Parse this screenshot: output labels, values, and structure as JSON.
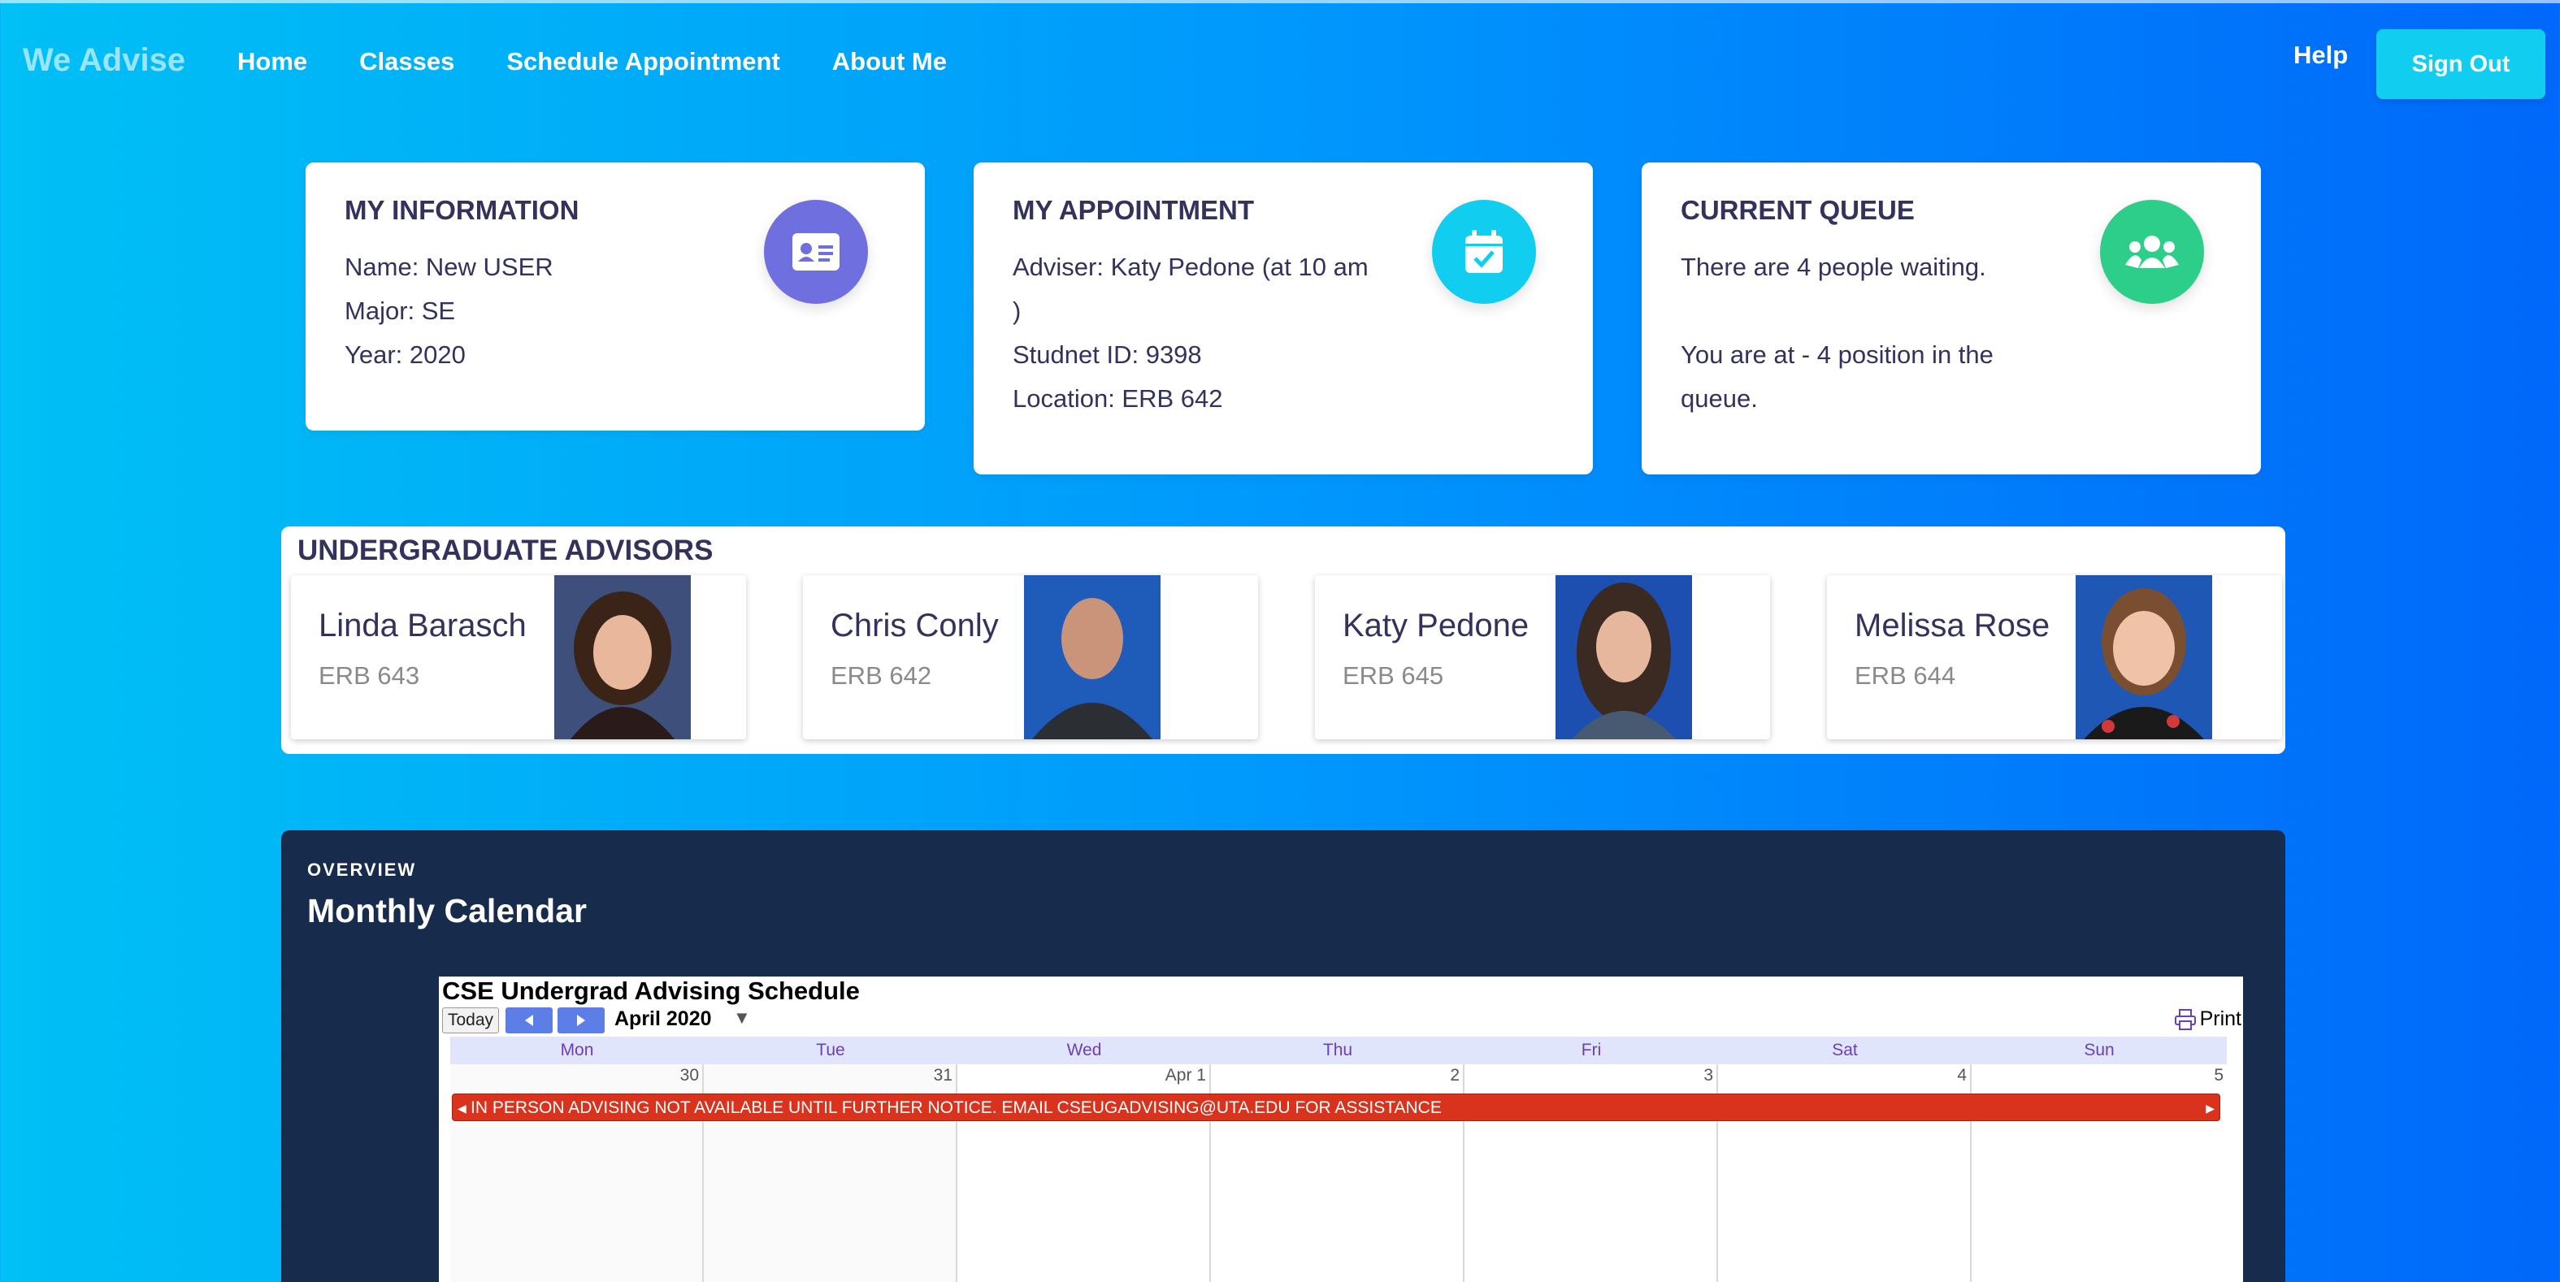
{
  "nav": {
    "brand": "We Advise",
    "links": [
      "Home",
      "Classes",
      "Schedule Appointment",
      "About Me"
    ],
    "help": "Help",
    "sign_out": "Sign Out"
  },
  "info_card": {
    "title": "MY INFORMATION",
    "lines": [
      "Name: New USER",
      "Major: SE",
      "Year: 2020"
    ],
    "icon": "id-card-icon",
    "icon_color": "#6f6fdf"
  },
  "appointment_card": {
    "title": "MY APPOINTMENT",
    "lines": [
      "Adviser: Katy Pedone (at 10 am",
      ")",
      "Studnet ID: 9398",
      "Location: ERB 642"
    ],
    "icon": "calendar-check-icon",
    "icon_color": "#11cdef"
  },
  "queue_card": {
    "title": "CURRENT QUEUE",
    "line1": "There are 4 people waiting.",
    "line2": "You are at - 4 position in the",
    "line3": "queue.",
    "icon": "users-icon",
    "icon_color": "#2dce89"
  },
  "advisors": {
    "title": "UNDERGRADUATE ADVISORS",
    "items": [
      {
        "name": "Linda Barasch",
        "room": "ERB 643"
      },
      {
        "name": "Chris Conly",
        "room": "ERB 642"
      },
      {
        "name": "Katy Pedone",
        "room": "ERB 645"
      },
      {
        "name": "Melissa Rose",
        "room": "ERB 644"
      }
    ]
  },
  "overview": {
    "label": "OVERVIEW",
    "title": "Monthly Calendar"
  },
  "calendar": {
    "title": "CSE Undergrad Advising Schedule",
    "today_label": "Today",
    "month": "April 2020",
    "print_label": "Print",
    "days": [
      "Mon",
      "Tue",
      "Wed",
      "Thu",
      "Fri",
      "Sat",
      "Sun"
    ],
    "dates": [
      "30",
      "31",
      "Apr 1",
      "2",
      "3",
      "4",
      "5"
    ],
    "event": "IN PERSON ADVISING NOT AVAILABLE UNTIL FURTHER NOTICE. EMAIL CSEUGADVISING@UTA.EDU FOR ASSISTANCE",
    "event_color": "#d9321d"
  }
}
